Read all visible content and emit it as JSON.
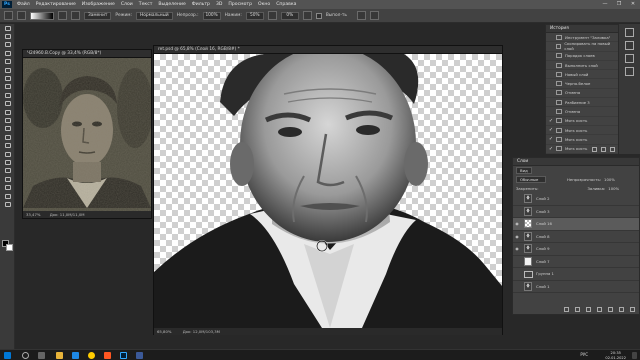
{
  "app": {
    "logo": "Ps"
  },
  "menu": [
    "Файл",
    "Редактирование",
    "Изображение",
    "Слои",
    "Текст",
    "Выделение",
    "Фильтр",
    "3D",
    "Просмотр",
    "Окно",
    "Справка"
  ],
  "window_controls": [
    "—",
    "❐",
    "✕"
  ],
  "options": {
    "gradient_type": "Заменит",
    "mode_label": "Режим:",
    "mode_value": "Нормальный",
    "opacity_label": "Непрозр.:",
    "opacity_value": "100%",
    "flow_label": "Нажим:",
    "flow_value": "50%",
    "zoom_value": "0%",
    "dither_label": "Выпол-ть"
  },
  "doc_back": {
    "title": "Ч24960.B.Copy @ 33,4% (RGB/8*)",
    "zoom": "33,47%",
    "status": "Док: 11,0М/11,0М"
  },
  "doc_front": {
    "title": "ret.psd @ 65,8% (Слой 16, RGB/8#) *",
    "zoom": "65,80%",
    "status": "Док: 12,0М/103,3М"
  },
  "history": {
    "title": "История",
    "items": [
      {
        "label": "Инструмент \"Заливка\"",
        "checked": false
      },
      {
        "label": "Скопировать на новый слой",
        "checked": false
      },
      {
        "label": "Порядок слоев",
        "checked": false
      },
      {
        "label": "Выполнить слой",
        "checked": false
      },
      {
        "label": "Новый слой",
        "checked": false
      },
      {
        "label": "Черно-белое",
        "checked": false
      },
      {
        "label": "Отмена",
        "checked": false
      },
      {
        "label": "Разбиение 3",
        "checked": false
      },
      {
        "label": "Отмена",
        "checked": false
      },
      {
        "label": "Мягк кисть",
        "checked": true
      },
      {
        "label": "Мягк кисть",
        "checked": true
      },
      {
        "label": "Мягк кисть",
        "checked": true
      },
      {
        "label": "Мягк кисть",
        "checked": true
      }
    ]
  },
  "layers": {
    "title": "Слои",
    "filter_label": "Вид",
    "blend_mode": "Обычные",
    "opacity_label": "Непрозрачность:",
    "opacity_value": "100%",
    "lock_label": "Закрепить:",
    "fill_label": "Заливка:",
    "fill_value": "100%",
    "items": [
      {
        "label": "Слой 2",
        "visible": false,
        "thumb": "face",
        "selected": false
      },
      {
        "label": "Слой 3",
        "visible": false,
        "thumb": "face",
        "selected": false
      },
      {
        "label": "Слой 16",
        "visible": true,
        "thumb": "chk",
        "selected": true
      },
      {
        "label": "Слой 8",
        "visible": true,
        "thumb": "face",
        "selected": false
      },
      {
        "label": "Слой 9",
        "visible": true,
        "thumb": "face",
        "selected": false
      },
      {
        "label": "Слой 7",
        "visible": false,
        "thumb": "white",
        "selected": false
      },
      {
        "label": "Группа 1",
        "visible": false,
        "thumb": "folder",
        "selected": false
      },
      {
        "label": "Слой 1",
        "visible": false,
        "thumb": "face",
        "selected": false
      }
    ]
  },
  "taskbar": {
    "time": "20:35",
    "date": "02.01.2022",
    "lang": "РУС"
  }
}
